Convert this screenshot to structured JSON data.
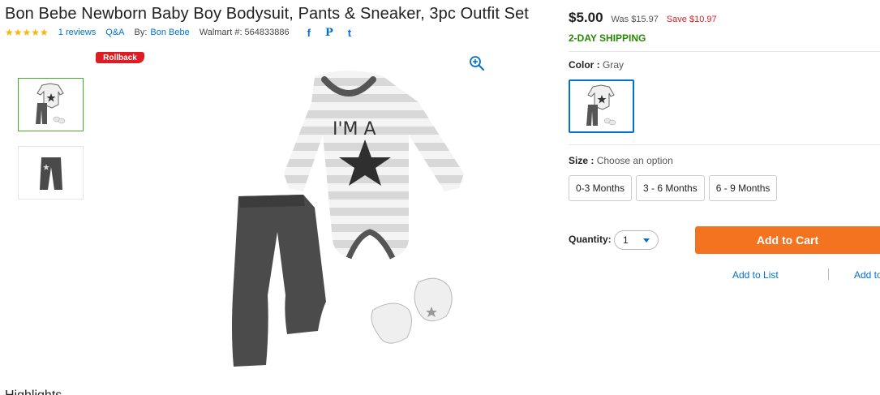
{
  "product": {
    "title": "Bon Bebe Newborn Baby Boy Bodysuit, Pants & Sneaker, 3pc Outfit Set",
    "rating_stars": "★★★★★",
    "reviews_link": "1 reviews",
    "qa_link": "Q&A",
    "by_label": "By:",
    "brand_link": "Bon Bebe",
    "walmart_number": "Walmart #: 564833886",
    "badge": "Rollback",
    "bodysuit_print": "I'M A"
  },
  "social": {
    "facebook": "f",
    "pinterest": "P",
    "twitter": "t"
  },
  "pricing": {
    "price": "$5.00",
    "was": "Was $15.97",
    "save": "Save $10.97",
    "shipping": "2-DAY SHIPPING"
  },
  "options": {
    "color_label": "Color :",
    "color_value": "Gray",
    "size_label": "Size :",
    "size_value": "Choose an option",
    "sizes": [
      "0-3 Months",
      "3 - 6 Months",
      "6 - 9 Months"
    ]
  },
  "purchase": {
    "quantity_label": "Quantity:",
    "quantity_value": "1",
    "add_to_cart": "Add to Cart",
    "add_to_list": "Add to List",
    "add_to_registry": "Add to Registry"
  },
  "section": {
    "highlights": "Highlights"
  },
  "colors": {
    "accent_blue": "#0071ce",
    "cart_orange": "#f47321",
    "save_red": "#de1c24",
    "shipping_green": "#2a8703",
    "star_yellow": "#f8b50d"
  },
  "icons": {
    "zoom": "zoom-in-icon",
    "caret": "chevron-down-icon"
  }
}
